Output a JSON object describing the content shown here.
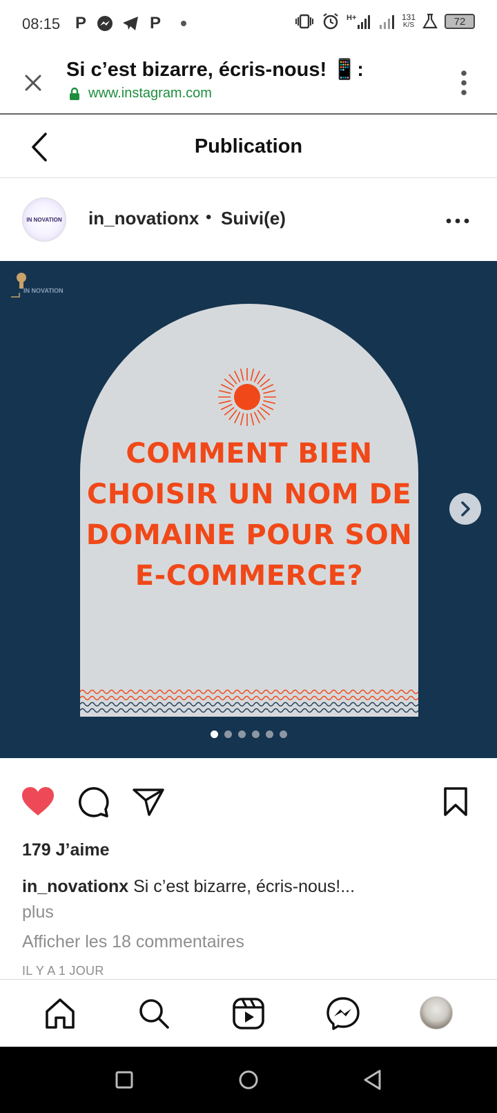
{
  "status_bar": {
    "time": "08:15",
    "left_icons": [
      "P",
      "messenger-icon",
      "telegram-icon",
      "P"
    ],
    "network": "H+",
    "speed_value": "131",
    "speed_unit": "K/S",
    "battery": "72"
  },
  "browser": {
    "title": "Si c’est bizarre, écris-nous! 📱:",
    "url": "www.instagram.com"
  },
  "header": {
    "title": "Publication"
  },
  "post": {
    "username": "in_novationx",
    "separator": "•",
    "follow_status": "Suivi(e)",
    "avatar_label": "IN NOVATION",
    "image": {
      "headline_lines": [
        "COMMENT BIEN",
        "CHOISIR UN NOM DE",
        "DOMAINE POUR SON",
        "E-COMMERCE?"
      ],
      "logo_text": "IN NOVATION",
      "carousel_total": 6,
      "carousel_active": 1,
      "colors": {
        "background": "#14344f",
        "arch": "#d6d9dc",
        "accent": "#f04818"
      }
    },
    "liked": true,
    "likes": "179 J’aime",
    "caption_user": "in_novationx",
    "caption_text": " Si c’est bizarre, écris-nous!...",
    "more_label": "plus",
    "comments_link": "Afficher les 18 commentaires",
    "timestamp": "IL Y A 1 JOUR"
  },
  "bottom_nav": [
    "home-icon",
    "search-icon",
    "reels-icon",
    "messenger-icon",
    "profile-avatar"
  ],
  "colors": {
    "like_red": "#ed4956",
    "url_green": "#1e8e3e"
  }
}
